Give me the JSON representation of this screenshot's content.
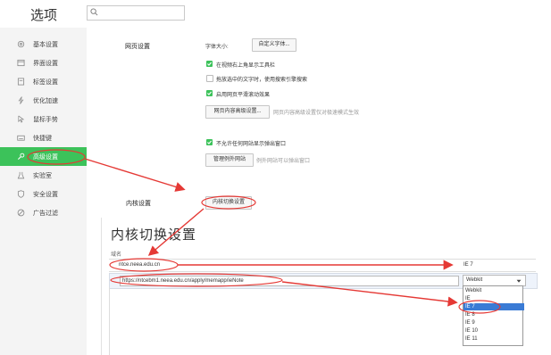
{
  "window": {
    "title": "选项"
  },
  "search": {
    "placeholder": ""
  },
  "sidebar": {
    "items": [
      {
        "label": "基本设置",
        "icon": "gear-icon"
      },
      {
        "label": "界面设置",
        "icon": "window-icon"
      },
      {
        "label": "标签设置",
        "icon": "tag-icon"
      },
      {
        "label": "优化加速",
        "icon": "lightning-icon"
      },
      {
        "label": "鼠标手势",
        "icon": "mouse-icon"
      },
      {
        "label": "快捷键",
        "icon": "keyboard-icon"
      },
      {
        "label": "高级设置",
        "icon": "wrench-icon",
        "active": true
      },
      {
        "label": "实验室",
        "icon": "flask-icon"
      },
      {
        "label": "安全设置",
        "icon": "shield-icon"
      },
      {
        "label": "广告过滤",
        "icon": "block-icon"
      }
    ]
  },
  "web_settings": {
    "section_label": "网页设置",
    "font_size_label": "字体大小:",
    "font_button": "自定义字体...",
    "opt1": "在视频右上角显示工具栏",
    "opt2": "拖放选中的文字时，使用搜索引擎搜索",
    "opt3": "启用网页平滑滚动效果",
    "opt1_checked": true,
    "opt2_checked": false,
    "opt3_checked": true,
    "content_button": "网页内容高级设置...",
    "content_hint": "网页内容高级设置仅对极速模式生效",
    "popup_opt": "不允许任何网站显示弹出窗口",
    "popup_checked": true,
    "exceptions_button": "管理例外网站",
    "exceptions_hint": "例外网站可以弹出窗口"
  },
  "kernel": {
    "section_label": "内核设置",
    "switch_button": "内核切换设置"
  },
  "kernel_panel": {
    "title": "内核切换设置",
    "domain_header": "域名",
    "row1_domain": "ntce.neea.edu.cn",
    "row1_mode": "IE 7",
    "row2_url": "https://ntcebm1.neea.edu.cn/apply/memapp/ieNote",
    "row2_select": "Webkit",
    "dropdown_options": [
      "Webkit",
      "IE",
      "IE 7",
      "IE 8",
      "IE 9",
      "IE 10",
      "IE 11"
    ],
    "dropdown_selected": "IE 7"
  },
  "colors": {
    "accent": "#3cc25a",
    "annotation": "#e53935",
    "selection": "#3a7bd5"
  }
}
